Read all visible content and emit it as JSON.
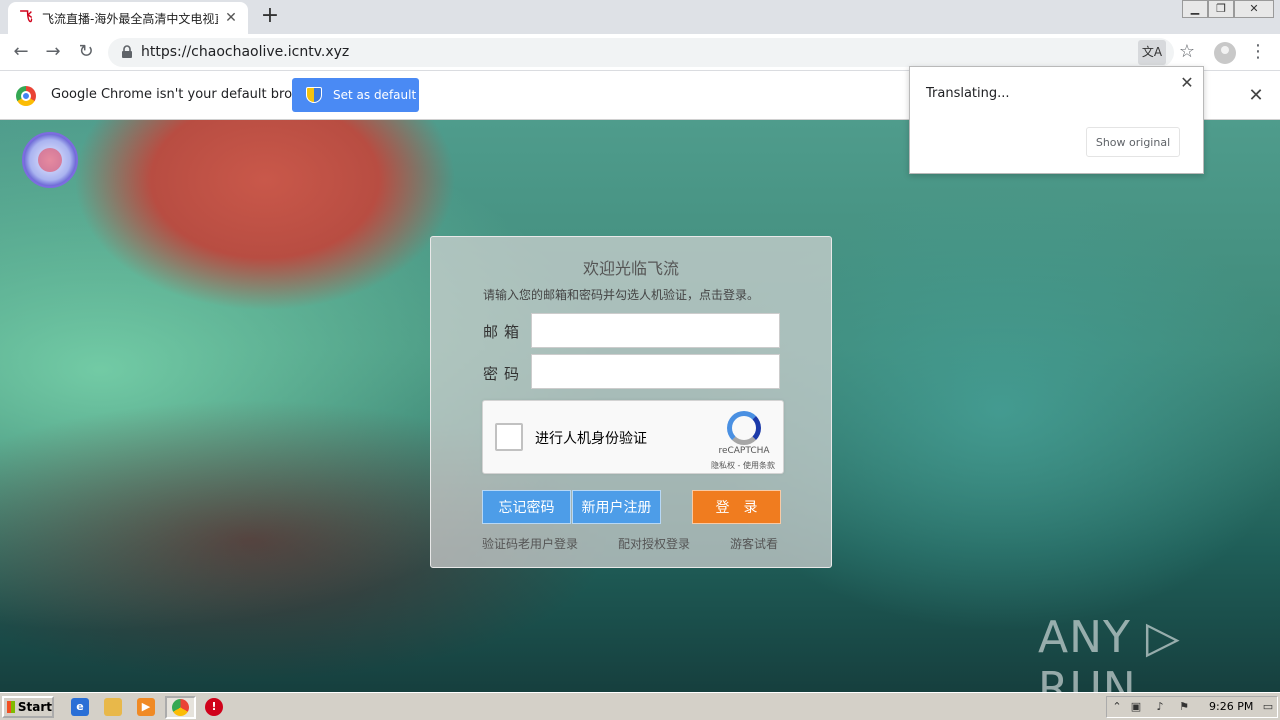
{
  "browser": {
    "tab": {
      "title": "飞流直播-海外最全高清中文电视直播",
      "favicon": "site-favicon"
    },
    "new_tab_symbol": "+",
    "window_controls": [
      "minimize",
      "restore",
      "close"
    ],
    "url": "https://chaochaolive.icntv.xyz",
    "infobar": {
      "message": "Google Chrome isn't your default browser",
      "button": "Set as default"
    },
    "translate_bubble": {
      "status": "Translating...",
      "button": "Show original"
    }
  },
  "login": {
    "title": "欢迎光临飞流",
    "hint": "请输入您的邮箱和密码并勾选人机验证，点击登录。",
    "email_label": "邮箱",
    "password_label": "密码",
    "email_value": "",
    "password_value": "",
    "captcha": {
      "label": "进行人机身份验证",
      "brand": "reCAPTCHA",
      "links": "隐私权 - 使用条款"
    },
    "buttons": {
      "forgot": "忘记密码",
      "register": "新用户注册",
      "login": "登录"
    },
    "links": {
      "verify_code": "验证码老用户登录",
      "pair_auth": "配对授权登录",
      "guest": "游客试看"
    }
  },
  "watermark": "ANY ▷ RUN",
  "taskbar": {
    "start_label": "Start",
    "clock": "9:26 PM",
    "quick_launch": [
      "ie-icon",
      "folder-icon",
      "media-player-icon",
      "chrome-icon",
      "antivirus-icon"
    ]
  },
  "colors": {
    "chrome_blue": "#4a8af4",
    "login_blue": "#4d9de8",
    "login_orange": "#f07c1f"
  }
}
